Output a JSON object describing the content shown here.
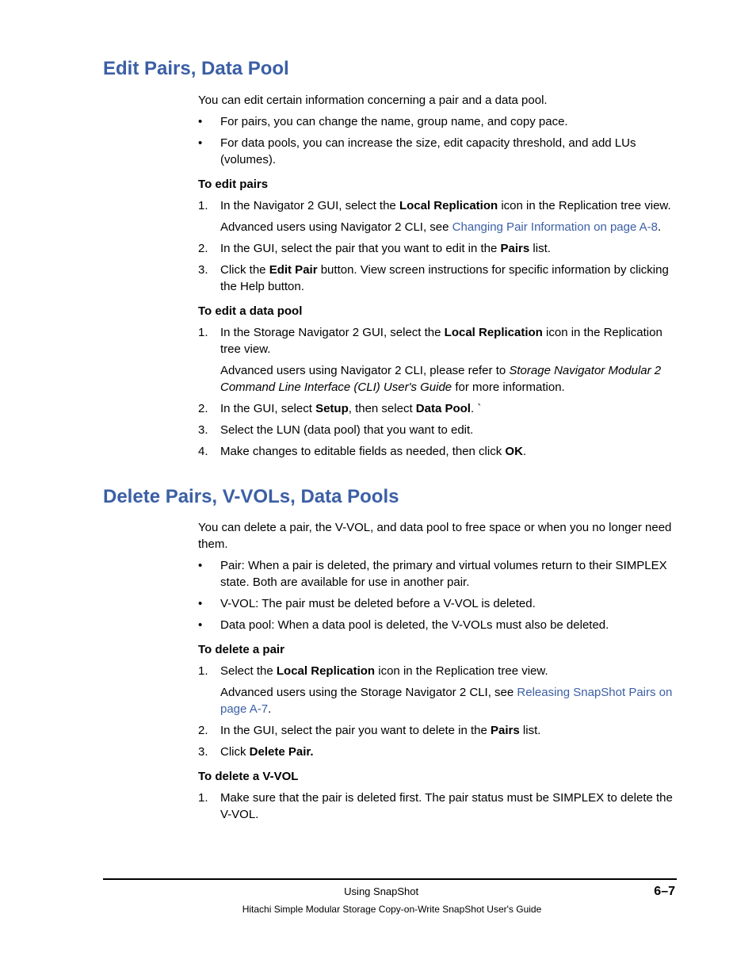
{
  "section1": {
    "heading": "Edit Pairs, Data Pool",
    "intro": "You can edit certain information concerning a pair and a data pool.",
    "bullets": [
      "For pairs, you can change the name, group name, and copy pace.",
      "For data pools, you can increase the size, edit capacity threshold, and add LUs (volumes)."
    ],
    "sub1": {
      "heading_prefix": "T",
      "heading_rest": "o edit pairs",
      "step1_a": "In the Navigator 2 GUI, select the ",
      "step1_bold": "Local Replication",
      "step1_b": " icon in the Replication tree view.",
      "step1_sub_a": "Advanced users using Navigator 2 CLI, see ",
      "step1_link": "Changing Pair Information on page A-8",
      "step1_sub_b": ".",
      "step2_a": "In the GUI, select the pair that you want to edit in the ",
      "step2_bold": "Pairs",
      "step2_b": " list.",
      "step3_a": "Click the ",
      "step3_bold": "Edit Pair",
      "step3_b": " button. View screen instructions for specific information by clicking the Help button."
    },
    "sub2": {
      "heading": "To edit a data pool",
      "step1_a": "In the Storage Navigator 2 GUI, select the ",
      "step1_bold": "Local Replication",
      "step1_b": " icon in the Replication tree view.",
      "step1_sub_a": "Advanced users using Navigator 2 CLI, please refer to ",
      "step1_italic": "Storage Navigator Modular 2 Command Line Interface (CLI) User's Guide",
      "step1_sub_b": " for more information.",
      "step2_a": "In the GUI, select ",
      "step2_bold1": "Setup",
      "step2_b": ", then select ",
      "step2_bold2": "Data Pool",
      "step2_c": ". `",
      "step3": "Select the LUN (data pool) that you want to edit.",
      "step4_a": "Make changes to editable fields as needed, then click ",
      "step4_bold": "OK",
      "step4_b": "."
    }
  },
  "section2": {
    "heading": "Delete Pairs, V-VOLs, Data Pools",
    "intro": "You can delete a pair, the V-VOL, and data pool to free space or when you no longer need them.",
    "bullets": [
      "Pair: When a pair is deleted, the primary and virtual volumes return to their SIMPLEX state. Both are available for use in another pair.",
      "V-VOL: The pair must be deleted before a V-VOL is deleted.",
      "Data pool: When a data pool is deleted, the V-VOLs must also be deleted."
    ],
    "sub1": {
      "heading": "To delete a pair",
      "step1_a": "Select the ",
      "step1_bold": "Local Replication",
      "step1_b": " icon in the Replication tree view.",
      "step1_sub_a": "Advanced users using the Storage Navigator 2 CLI, see ",
      "step1_link": "Releasing SnapShot Pairs on page A-7",
      "step1_sub_b": ".",
      "step2_a": "In the GUI, select the pair you want to delete in the ",
      "step2_bold": "Pairs",
      "step2_b": " list.",
      "step3_a": "Click ",
      "step3_bold": "Delete Pair."
    },
    "sub2": {
      "heading": "To delete a V-VOL",
      "step1": "Make sure that the pair is deleted first. The pair status must be SIMPLEX to delete the V-VOL."
    }
  },
  "footer": {
    "center": "Using SnapShot",
    "right": "6–7",
    "bottom": "Hitachi Simple Modular Storage Copy-on-Write SnapShot User's Guide"
  }
}
